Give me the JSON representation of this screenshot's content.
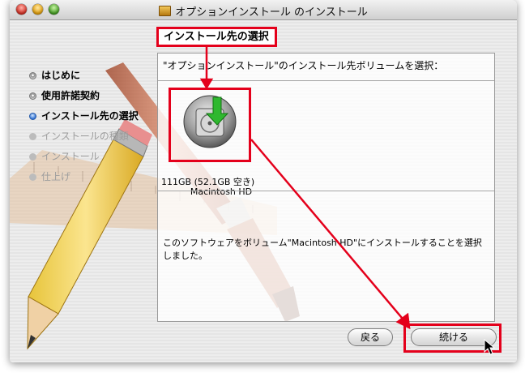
{
  "window": {
    "title": "オプションインストール のインストール",
    "title_icon": "package-icon"
  },
  "step_title": "インストール先の選択",
  "steps": [
    {
      "label": "はじめに",
      "state": "done"
    },
    {
      "label": "使用許諾契約",
      "state": "done"
    },
    {
      "label": "インストール先の選択",
      "state": "current"
    },
    {
      "label": "インストールの種類",
      "state": "todo"
    },
    {
      "label": "インストール",
      "state": "todo"
    },
    {
      "label": "仕上げ",
      "state": "todo"
    }
  ],
  "panel": {
    "prompt": "\"オプションインストール\"のインストール先ボリュームを選択：",
    "disk": {
      "name": "Macintosh HD",
      "size": "111GB (52.1GB 空き)",
      "icon": "hard-disk-icon"
    },
    "description": "このソフトウェアをボリューム\"Macintosh HD\"にインストールすることを選択しました。"
  },
  "buttons": {
    "back": "戻る",
    "continue": "続ける"
  },
  "colors": {
    "annotation_red": "#e4001b",
    "current_step_blue": "#2f6fd0"
  }
}
